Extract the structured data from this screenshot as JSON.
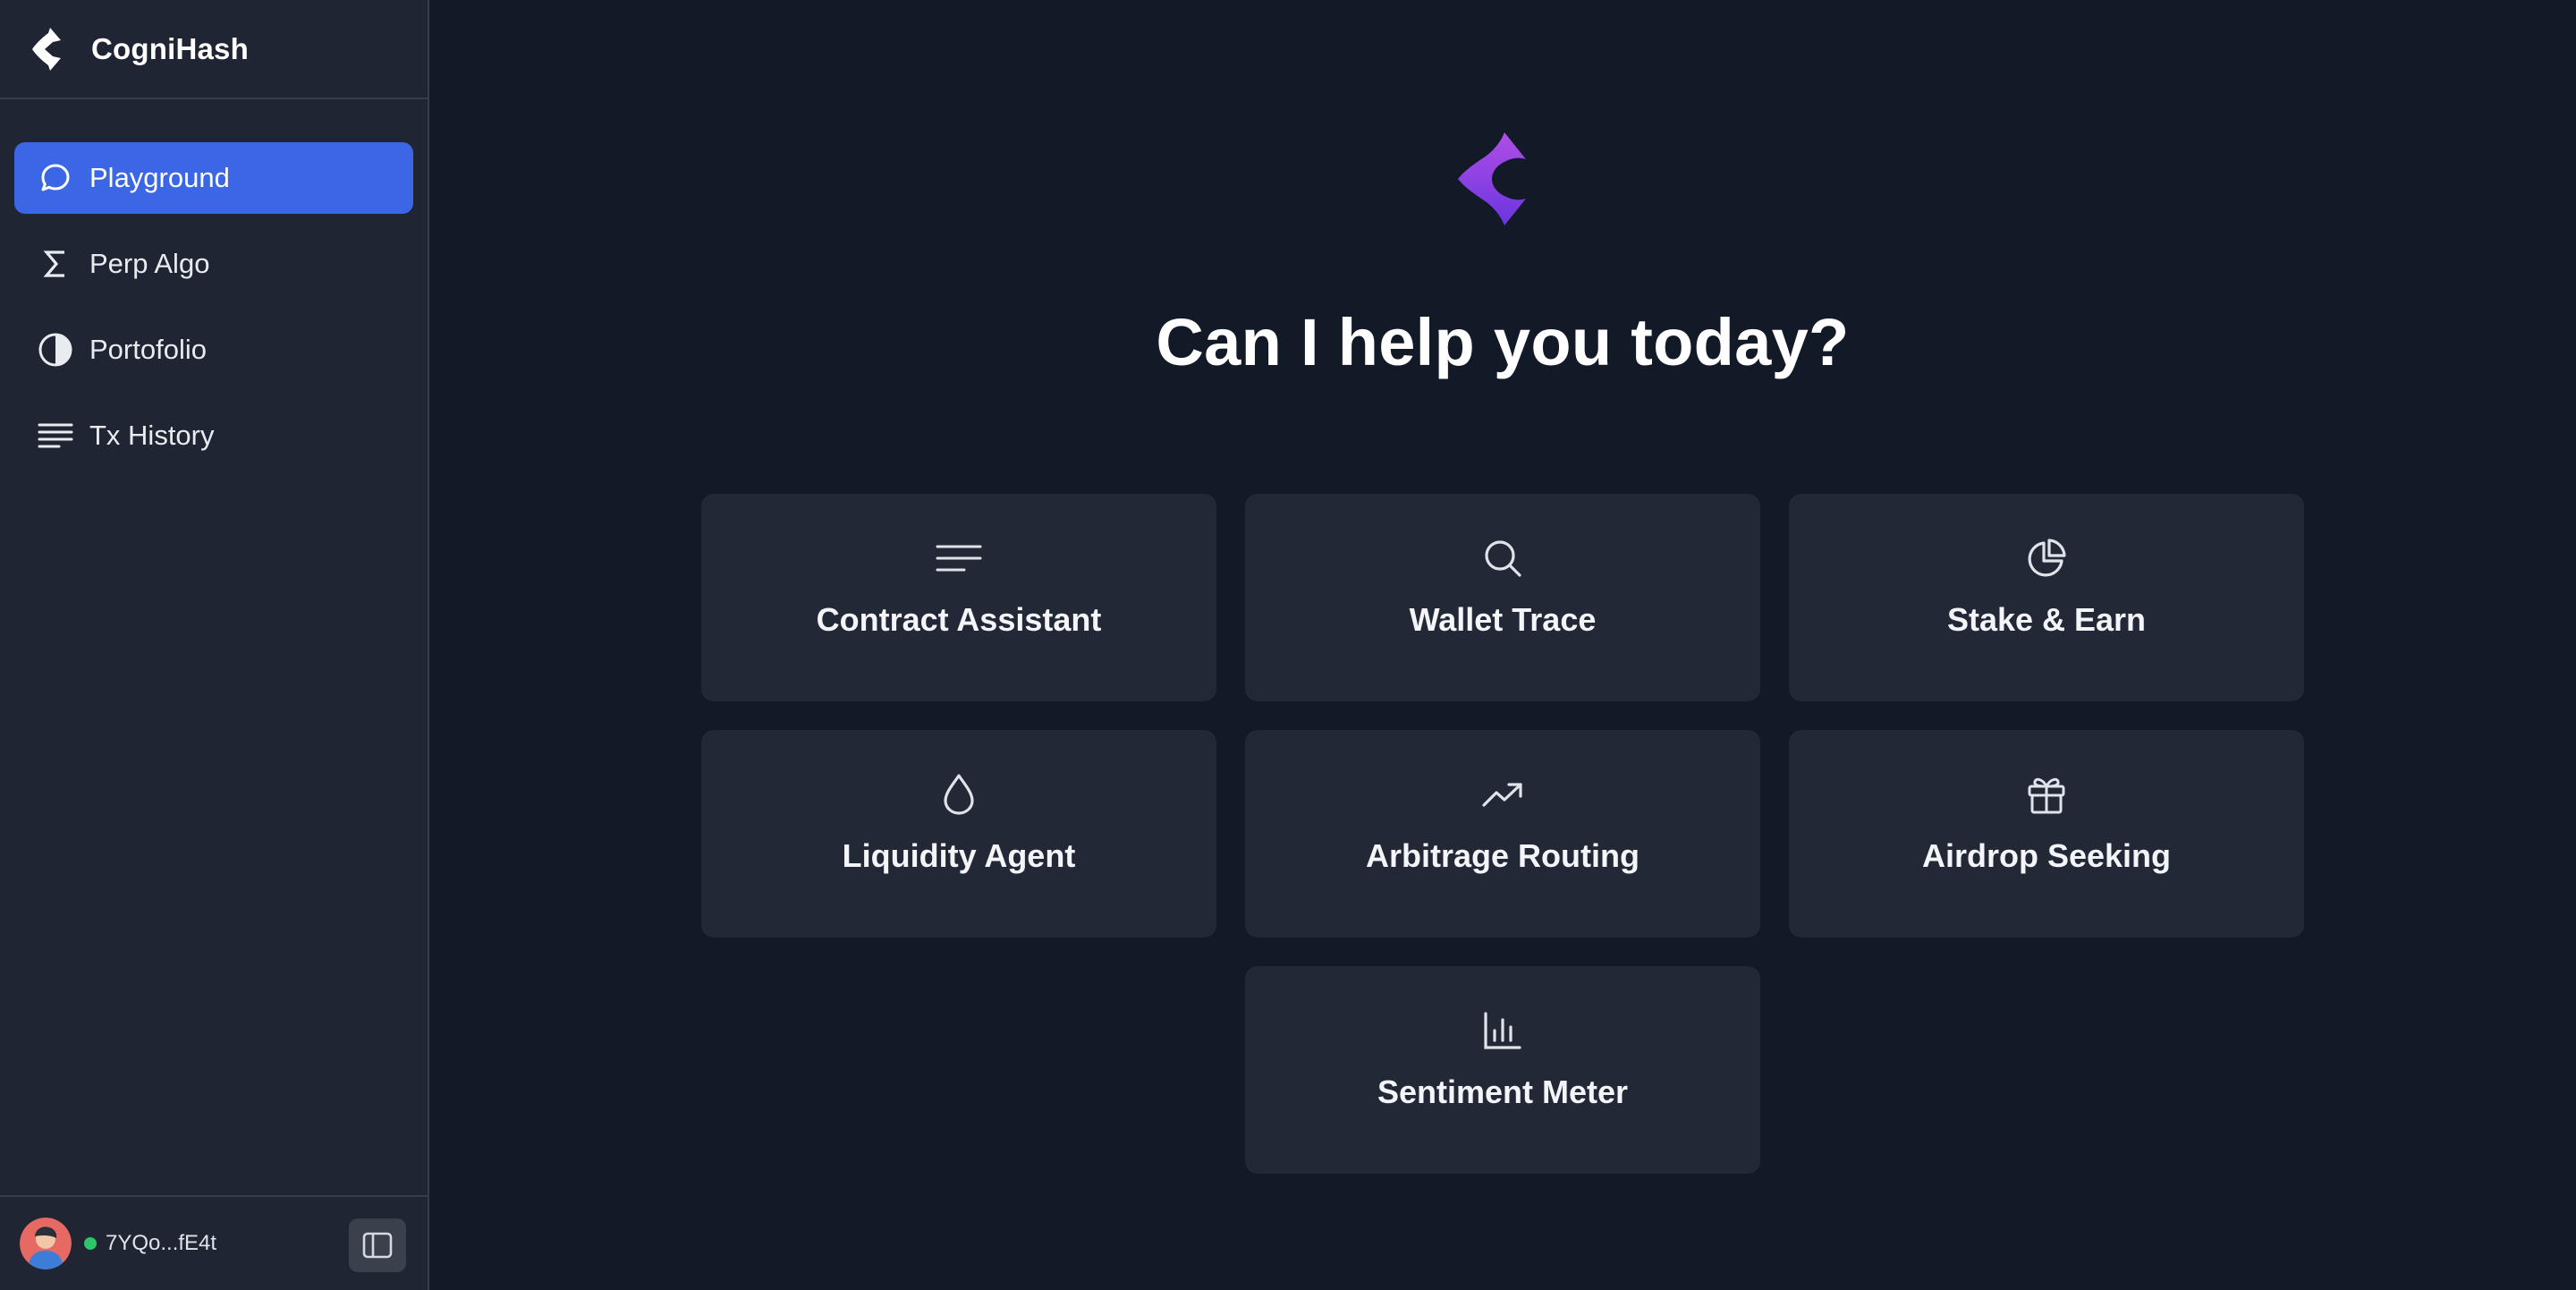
{
  "app": {
    "name": "CogniHash"
  },
  "sidebar": {
    "items": [
      {
        "label": "Playground",
        "icon": "chat-bubble-icon",
        "active": true
      },
      {
        "label": "Perp Algo",
        "icon": "sigma-icon",
        "active": false
      },
      {
        "label": "Portofolio",
        "icon": "half-circle-icon",
        "active": false
      },
      {
        "label": "Tx History",
        "icon": "lines-icon",
        "active": false
      }
    ],
    "footer": {
      "wallet": "7YQo...fE4t",
      "status_color": "#2fc36a"
    }
  },
  "main": {
    "heading": "Can I help you today?",
    "cards": [
      {
        "label": "Contract Assistant",
        "icon": "text-lines-icon"
      },
      {
        "label": "Wallet Trace",
        "icon": "search-icon"
      },
      {
        "label": "Stake & Earn",
        "icon": "pie-chart-icon"
      },
      {
        "label": "Liquidity Agent",
        "icon": "droplet-icon"
      },
      {
        "label": "Arbitrage Routing",
        "icon": "trending-up-icon"
      },
      {
        "label": "Airdrop Seeking",
        "icon": "gift-icon"
      },
      {
        "label": "Sentiment Meter",
        "icon": "bar-chart-icon"
      }
    ]
  },
  "colors": {
    "background": "#131a27",
    "sidebar": "#1f2532",
    "accent": "#3b66e5",
    "card": "#222835",
    "brand_purple": "#8b3fe0"
  }
}
